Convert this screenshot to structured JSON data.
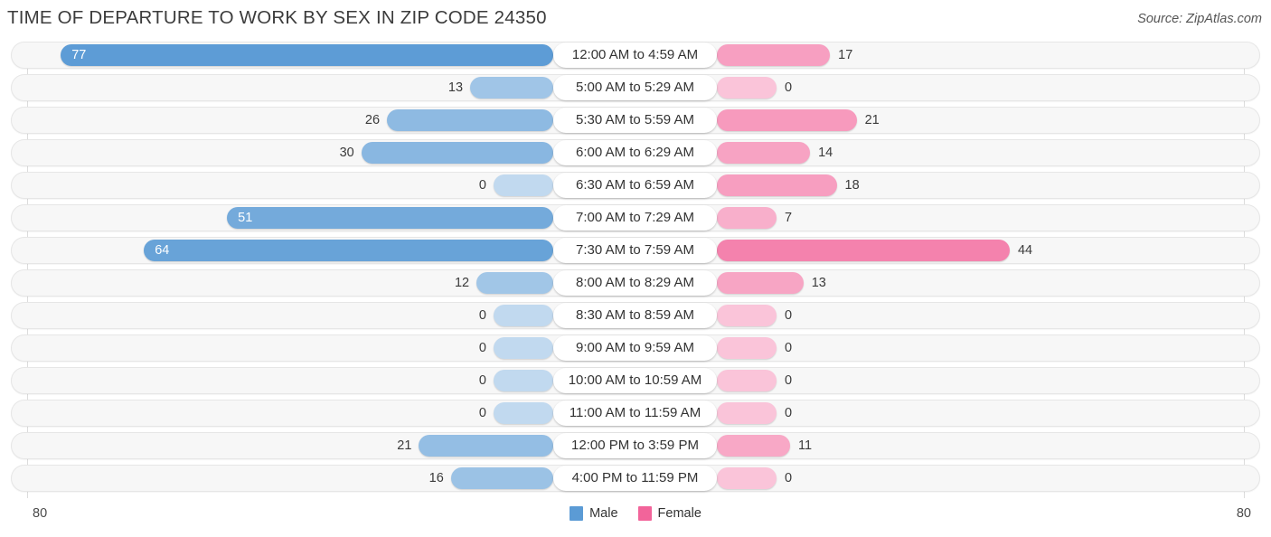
{
  "header": {
    "title": "TIME OF DEPARTURE TO WORK BY SEX IN ZIP CODE 24350",
    "source": "Source: ZipAtlas.com"
  },
  "legend": {
    "male_label": "Male",
    "female_label": "Female",
    "male_color": "#5b9bd5",
    "female_color": "#f2649a"
  },
  "axis": {
    "left_end": "80",
    "right_end": "80",
    "max": 80
  },
  "chart_data": {
    "type": "bar",
    "orientation": "horizontal-diverging",
    "title": "TIME OF DEPARTURE TO WORK BY SEX IN ZIP CODE 24350",
    "xlabel": "",
    "ylabel": "",
    "xlim": [
      80,
      80
    ],
    "grid": false,
    "legend_position": "bottom-center",
    "categories": [
      "12:00 AM to 4:59 AM",
      "5:00 AM to 5:29 AM",
      "5:30 AM to 5:59 AM",
      "6:00 AM to 6:29 AM",
      "6:30 AM to 6:59 AM",
      "7:00 AM to 7:29 AM",
      "7:30 AM to 7:59 AM",
      "8:00 AM to 8:29 AM",
      "8:30 AM to 8:59 AM",
      "9:00 AM to 9:59 AM",
      "10:00 AM to 10:59 AM",
      "11:00 AM to 11:59 AM",
      "12:00 PM to 3:59 PM",
      "4:00 PM to 11:59 PM"
    ],
    "series": [
      {
        "name": "Male",
        "color": "#5b9bd5",
        "values": [
          77,
          13,
          26,
          30,
          0,
          51,
          64,
          12,
          0,
          0,
          0,
          0,
          21,
          16
        ]
      },
      {
        "name": "Female",
        "color": "#f2649a",
        "values": [
          17,
          0,
          21,
          14,
          18,
          7,
          44,
          13,
          0,
          0,
          0,
          0,
          11,
          0
        ]
      }
    ]
  }
}
